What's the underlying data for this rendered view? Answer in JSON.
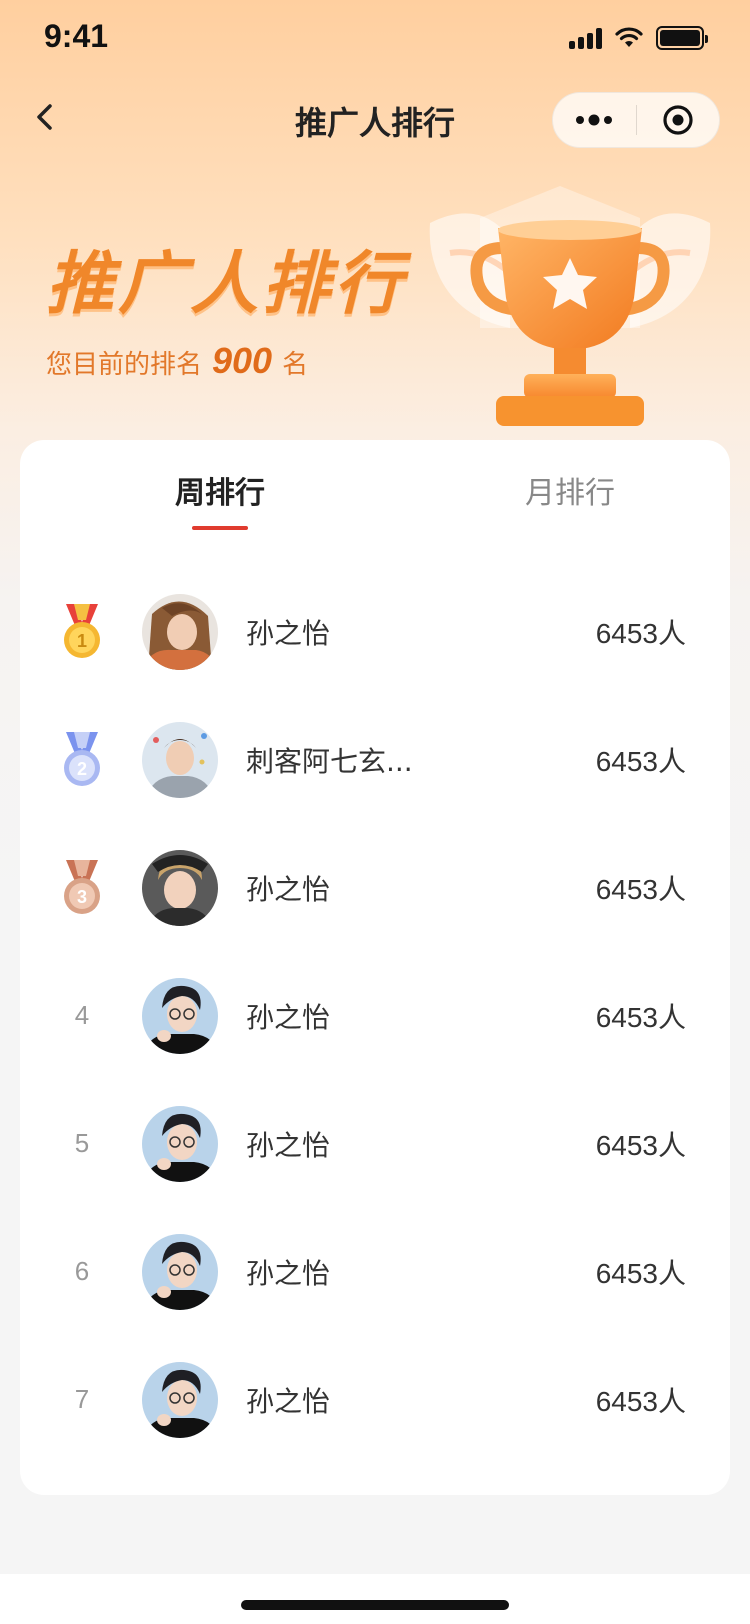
{
  "status_bar": {
    "time": "9:41"
  },
  "nav": {
    "title": "推广人排行"
  },
  "hero": {
    "title": "推广人排行",
    "rank_prefix": "您目前的排名",
    "rank_value": "900",
    "rank_suffix": "名"
  },
  "tabs": [
    {
      "label": "周排行",
      "active": true
    },
    {
      "label": "月排行",
      "active": false
    }
  ],
  "ranking": [
    {
      "rank": "1",
      "medal": "gold",
      "name": "孙之怡",
      "count": "6453人",
      "avatar": "girl"
    },
    {
      "rank": "2",
      "medal": "silver",
      "name": "刺客阿七玄...",
      "count": "6453人",
      "avatar": "boy-gray"
    },
    {
      "rank": "3",
      "medal": "bronze",
      "name": "孙之怡",
      "count": "6453人",
      "avatar": "boy-hat"
    },
    {
      "rank": "4",
      "medal": "",
      "name": "孙之怡",
      "count": "6453人",
      "avatar": "boy-glasses"
    },
    {
      "rank": "5",
      "medal": "",
      "name": "孙之怡",
      "count": "6453人",
      "avatar": "boy-glasses"
    },
    {
      "rank": "6",
      "medal": "",
      "name": "孙之怡",
      "count": "6453人",
      "avatar": "boy-glasses"
    },
    {
      "rank": "7",
      "medal": "",
      "name": "孙之怡",
      "count": "6453人",
      "avatar": "boy-glasses"
    }
  ],
  "colors": {
    "accent": "#e03b2e",
    "hero_text": "#f0872a",
    "gold": "#f5b731",
    "silver": "#a9b8f2",
    "bronze": "#d9a287"
  }
}
